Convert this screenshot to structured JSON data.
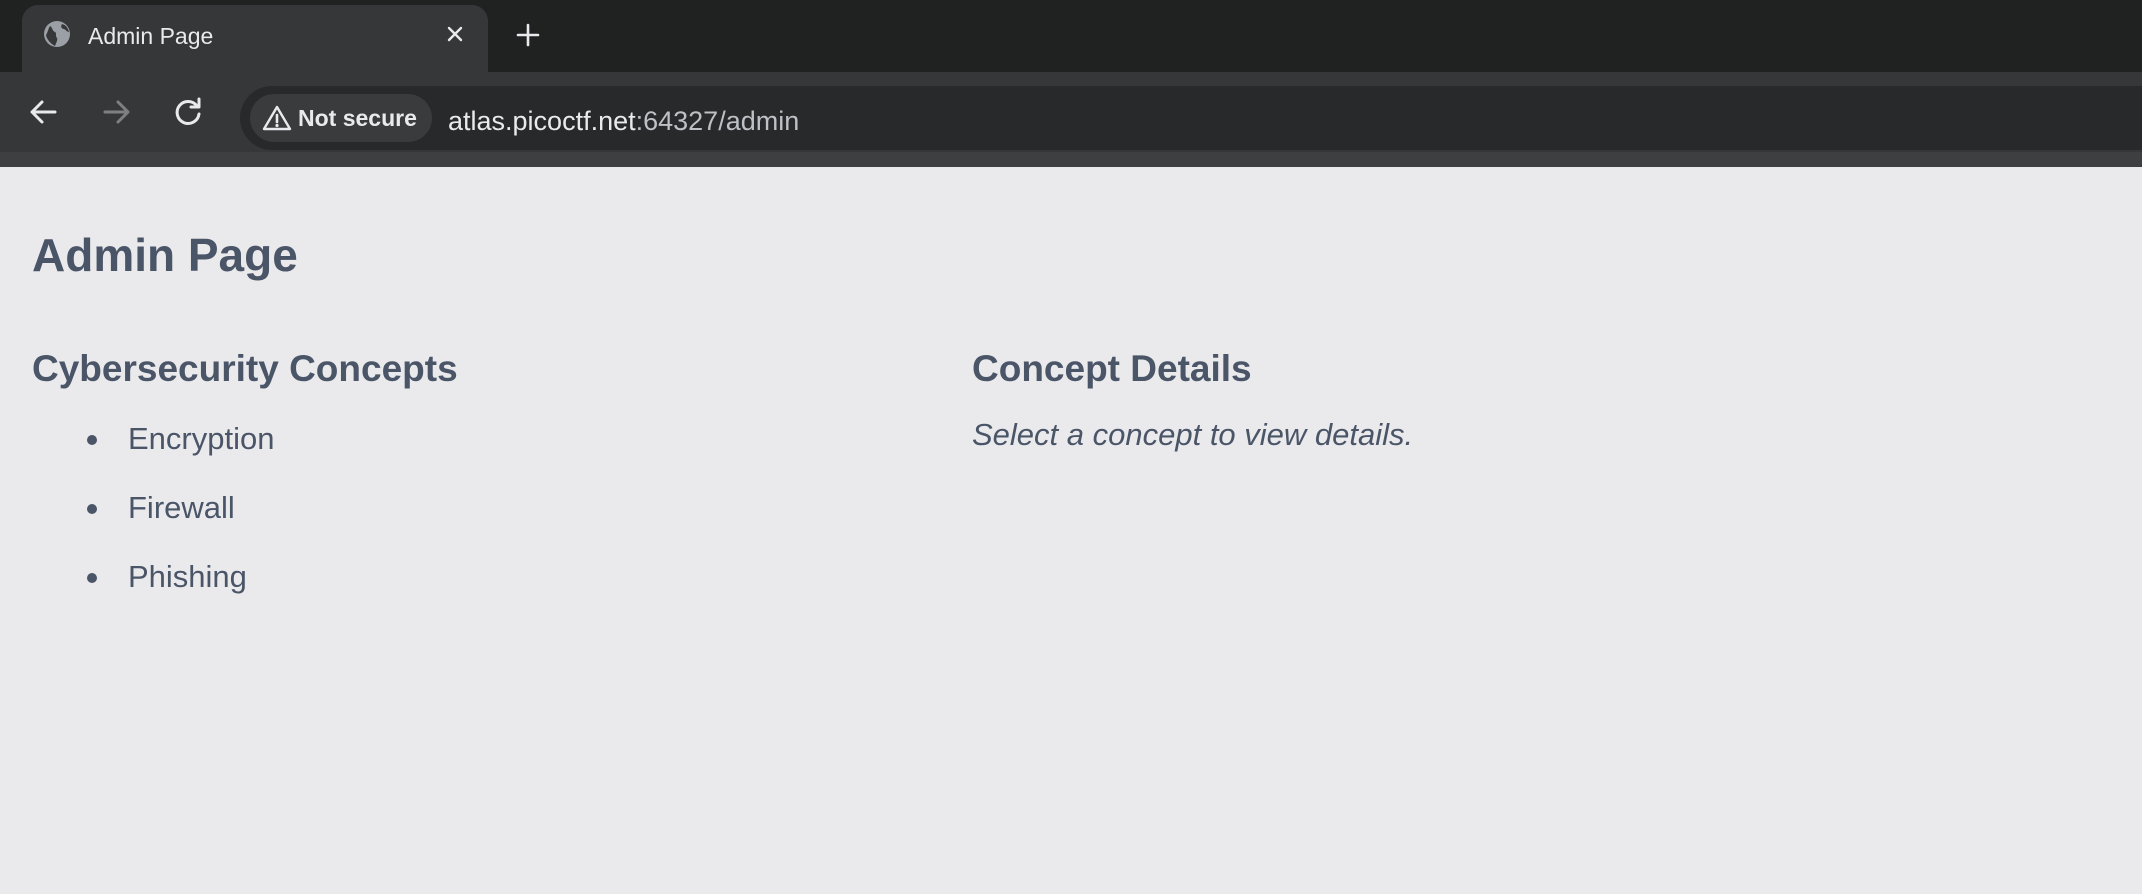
{
  "browser": {
    "tab": {
      "title": "Admin Page",
      "favicon_icon": "globe-icon",
      "close_icon": "close-icon"
    },
    "new_tab_icon": "plus-icon",
    "toolbar": {
      "back_icon": "arrow-left-icon",
      "forward_icon": "arrow-right-icon",
      "reload_icon": "reload-icon"
    },
    "omnibox": {
      "security_icon": "warning-triangle-icon",
      "security_label": "Not secure",
      "url_host": "atlas.picoctf.net",
      "url_rest": ":64327/admin"
    }
  },
  "page": {
    "title": "Admin Page",
    "concepts": {
      "heading": "Cybersecurity Concepts",
      "items": [
        "Encryption",
        "Firewall",
        "Phishing"
      ]
    },
    "details": {
      "heading": "Concept Details",
      "placeholder": "Select a concept to view details."
    }
  },
  "colors": {
    "page_background": "#eaeaec",
    "text": "#4a5568",
    "chrome_dark": "#202221",
    "chrome_toolbar": "#363738"
  }
}
